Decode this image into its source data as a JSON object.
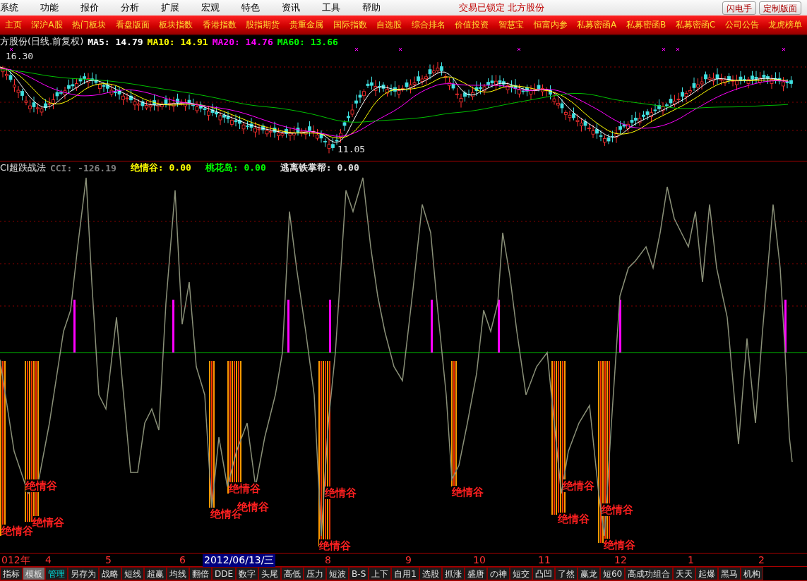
{
  "menu": [
    "系统",
    "功能",
    "报价",
    "分析",
    "扩展",
    "宏观",
    "特色",
    "资讯",
    "工具",
    "帮助"
  ],
  "status": "交易已锁定  北方股份",
  "toolbar_buttons": [
    "闪电手",
    "定制版面"
  ],
  "nav_tabs": [
    "主页",
    "深沪A股",
    "热门板块",
    "看盘版面",
    "板块指数",
    "香港指数",
    "股指期货",
    "贵重金属",
    "国际指数",
    "自选股",
    "综合排名",
    "价值投资",
    "智慧宝",
    "恒富内参",
    "私募密函A",
    "私募密函B",
    "私募密函C",
    "公司公告",
    "龙虎榜单"
  ],
  "price_pane": {
    "title": "方股份(日线.前复权)",
    "legend": [
      {
        "label": "MA5: 14.79",
        "color": "#ffffff"
      },
      {
        "label": "MA10: 14.91",
        "color": "#ffff00"
      },
      {
        "label": "MA20: 14.76",
        "color": "#ff00ff"
      },
      {
        "label": "MA60: 13.66",
        "color": "#00ff00"
      }
    ],
    "high_label": "16.30",
    "low_label": "11.05"
  },
  "indicator_pane": {
    "title": "CI超跌战法",
    "legend": [
      {
        "label": "CCI: -126.19",
        "color": "#808080"
      },
      {
        "label": "绝情谷: 0.00",
        "color": "#ffff00"
      },
      {
        "label": "桃花岛: 0.00",
        "color": "#00ff00"
      },
      {
        "label": "逃离铁掌帮: 0.00",
        "color": "#e0e0e0"
      }
    ],
    "signals": [
      "绝情谷",
      "绝情谷",
      "绝情谷",
      "绝情谷",
      "绝情谷",
      "绝情谷",
      "绝情谷",
      "绝情谷",
      "绝情谷",
      "绝情谷",
      "绝情谷",
      "绝情谷",
      "绝情谷"
    ]
  },
  "time_axis": [
    {
      "label": "012年",
      "selected": false
    },
    {
      "label": "4",
      "selected": false
    },
    {
      "label": "5",
      "selected": false
    },
    {
      "label": "6",
      "selected": false
    },
    {
      "label": "2012/06/13/三",
      "selected": true
    },
    {
      "label": "8",
      "selected": false
    },
    {
      "label": "9",
      "selected": false
    },
    {
      "label": "10",
      "selected": false
    },
    {
      "label": "11",
      "selected": false
    },
    {
      "label": "12",
      "selected": false
    },
    {
      "label": "1",
      "selected": false
    },
    {
      "label": "2",
      "selected": false
    }
  ],
  "bottom_tabs": [
    {
      "label": "指标",
      "selected": false,
      "highlighted": false
    },
    {
      "label": "模板",
      "selected": true,
      "highlighted": false
    },
    {
      "label": "管理",
      "selected": false,
      "highlighted": true
    },
    {
      "label": "另存为",
      "selected": false,
      "highlighted": false
    },
    {
      "label": "战略",
      "selected": false,
      "highlighted": false
    },
    {
      "label": "短线",
      "selected": false,
      "highlighted": false
    },
    {
      "label": "超赢",
      "selected": false,
      "highlighted": false
    },
    {
      "label": "均线",
      "selected": false,
      "highlighted": false
    },
    {
      "label": "翻倍",
      "selected": false,
      "highlighted": false
    },
    {
      "label": "DDE",
      "selected": false,
      "highlighted": false
    },
    {
      "label": "数字",
      "selected": false,
      "highlighted": false
    },
    {
      "label": "头尾",
      "selected": false,
      "highlighted": false
    },
    {
      "label": "高低",
      "selected": false,
      "highlighted": false
    },
    {
      "label": "压力",
      "selected": false,
      "highlighted": false
    },
    {
      "label": "短波",
      "selected": false,
      "highlighted": false
    },
    {
      "label": "B-S",
      "selected": false,
      "highlighted": false
    },
    {
      "label": "上下",
      "selected": false,
      "highlighted": false
    },
    {
      "label": "自用1",
      "selected": false,
      "highlighted": false
    },
    {
      "label": "选股",
      "selected": false,
      "highlighted": false
    },
    {
      "label": "抓涨",
      "selected": false,
      "highlighted": false
    },
    {
      "label": "盛唐",
      "selected": false,
      "highlighted": false
    },
    {
      "label": "の神",
      "selected": false,
      "highlighted": false
    },
    {
      "label": "短交",
      "selected": false,
      "highlighted": false
    },
    {
      "label": "凸凹",
      "selected": false,
      "highlighted": false
    },
    {
      "label": "了然",
      "selected": false,
      "highlighted": false
    },
    {
      "label": "赢龙",
      "selected": false,
      "highlighted": false
    },
    {
      "label": "短60",
      "selected": false,
      "highlighted": false
    },
    {
      "label": "高成功组合",
      "selected": false,
      "highlighted": false
    },
    {
      "label": "天天",
      "selected": false,
      "highlighted": false
    },
    {
      "label": "起爆",
      "selected": false,
      "highlighted": false
    },
    {
      "label": "黑马",
      "selected": false,
      "highlighted": false
    },
    {
      "label": "机构",
      "selected": false,
      "highlighted": false
    }
  ]
}
